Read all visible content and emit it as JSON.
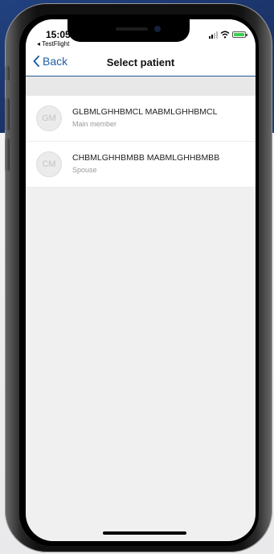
{
  "status_bar": {
    "time": "15:05",
    "location_arrow": "↗",
    "return_app": "◂ TestFlight",
    "battery_color": "#3ccf4e"
  },
  "navigation": {
    "back_label": "Back",
    "title": "Select patient"
  },
  "patients": [
    {
      "initials": "GM",
      "name": "GLBMLGHHBMCL MABMLGHHBMCL",
      "relation": "Main member"
    },
    {
      "initials": "CM",
      "name": "CHBMLGHHBMBB MABMLGHHBMBB",
      "relation": "Spouse"
    }
  ],
  "colors": {
    "accent": "#1f5fa8",
    "background_navy": "#1e3a73"
  }
}
